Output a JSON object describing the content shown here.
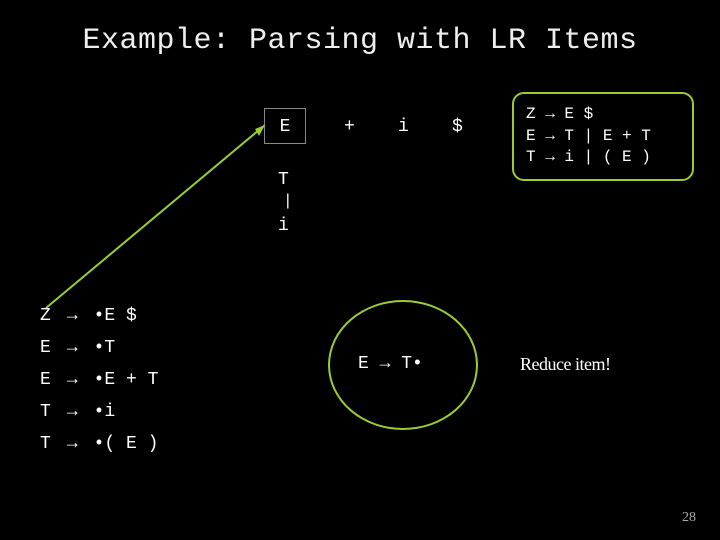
{
  "title": "Example: Parsing with LR Items",
  "stack_cell": "E",
  "input": {
    "plus": "+",
    "i": "i",
    "end": "$"
  },
  "derivation": {
    "top": "T",
    "bar": "|",
    "bottom": "i"
  },
  "grammar": {
    "line1": "Z → E $",
    "line2": "E → T | E + T",
    "line3": "T → i | ( E )"
  },
  "items": [
    {
      "lhs": "Z",
      "arrow": "→",
      "rhs": "•E $"
    },
    {
      "lhs": "E",
      "arrow": "→",
      "rhs": "•T"
    },
    {
      "lhs": "E",
      "arrow": "→",
      "rhs": "•E + T"
    },
    {
      "lhs": "T",
      "arrow": "→",
      "rhs": "•i"
    },
    {
      "lhs": "T",
      "arrow": "→",
      "rhs": "•( E )"
    }
  ],
  "reduce_item": "E  →  T•",
  "reduce_label": "Reduce item!",
  "page": "28",
  "colors": {
    "accent": "#9ACD32"
  }
}
